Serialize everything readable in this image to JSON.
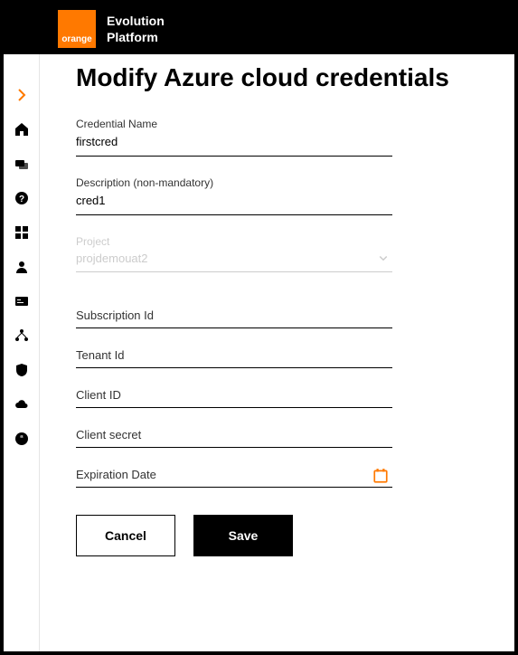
{
  "brand": {
    "logo_text": "orange",
    "title_line1": "Evolution",
    "title_line2": "Platform"
  },
  "page": {
    "title": "Modify Azure cloud credentials"
  },
  "form": {
    "credential_name": {
      "label": "Credential Name",
      "value": "firstcred"
    },
    "description": {
      "label": "Description (non-mandatory)",
      "value": "cred1"
    },
    "project": {
      "label": "Project",
      "value": "projdemouat2"
    },
    "subscription_id": {
      "label": "Subscription Id",
      "value": ""
    },
    "tenant_id": {
      "label": "Tenant Id",
      "value": ""
    },
    "client_id": {
      "label": "Client ID",
      "value": ""
    },
    "client_secret": {
      "label": "Client secret",
      "value": ""
    },
    "expiration_date": {
      "label": "Expiration Date",
      "value": ""
    }
  },
  "buttons": {
    "cancel": "Cancel",
    "save": "Save"
  },
  "colors": {
    "accent": "#ff7900",
    "text": "#000000",
    "disabled": "#cccccc"
  }
}
